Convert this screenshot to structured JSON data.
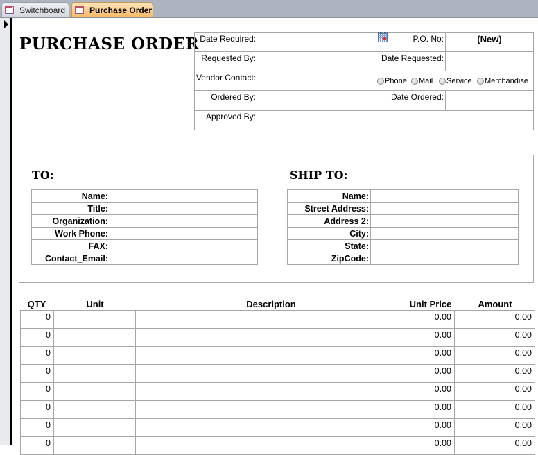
{
  "tabs": [
    {
      "label": "Switchboard",
      "active": false,
      "icon": "form-icon"
    },
    {
      "label": "Purchase Order",
      "active": true,
      "icon": "form-icon"
    }
  ],
  "form": {
    "title": "PURCHASE ORDER",
    "header_fields": {
      "date_required": {
        "label": "Date Required:",
        "value": ""
      },
      "requested_by": {
        "label": "Requested By:",
        "value": ""
      },
      "vendor_contact": {
        "label": "Vendor Contact:",
        "value": ""
      },
      "ordered_by": {
        "label": "Ordered By:",
        "value": ""
      },
      "approved_by": {
        "label": "Approved By:",
        "value": ""
      },
      "po_no": {
        "label": "P.O. No:",
        "value": "(New)"
      },
      "date_requested": {
        "label": "Date Requested:",
        "value": ""
      },
      "date_ordered": {
        "label": "Date Ordered:",
        "value": ""
      }
    },
    "order_type_options": [
      "Phone",
      "Mail",
      "Service",
      "Merchandise"
    ],
    "to": {
      "heading": "TO:",
      "fields": [
        {
          "label": "Name:",
          "value": ""
        },
        {
          "label": "Title:",
          "value": ""
        },
        {
          "label": "Organization:",
          "value": ""
        },
        {
          "label": "Work Phone:",
          "value": ""
        },
        {
          "label": "FAX:",
          "value": ""
        },
        {
          "label": "Contact_Email:",
          "value": ""
        }
      ]
    },
    "ship_to": {
      "heading": "SHIP TO:",
      "fields": [
        {
          "label": "Name:",
          "value": ""
        },
        {
          "label": "Street Address:",
          "value": ""
        },
        {
          "label": "Address 2:",
          "value": ""
        },
        {
          "label": "City:",
          "value": ""
        },
        {
          "label": "State:",
          "value": ""
        },
        {
          "label": "ZipCode:",
          "value": ""
        }
      ]
    },
    "line_items": {
      "columns": [
        "QTY",
        "Unit",
        "Description",
        "Unit Price",
        "Amount"
      ],
      "rows": [
        {
          "qty": "0",
          "unit": "",
          "description": "",
          "unit_price": "0.00",
          "amount": "0.00"
        },
        {
          "qty": "0",
          "unit": "",
          "description": "",
          "unit_price": "0.00",
          "amount": "0.00"
        },
        {
          "qty": "0",
          "unit": "",
          "description": "",
          "unit_price": "0.00",
          "amount": "0.00"
        },
        {
          "qty": "0",
          "unit": "",
          "description": "",
          "unit_price": "0.00",
          "amount": "0.00"
        },
        {
          "qty": "0",
          "unit": "",
          "description": "",
          "unit_price": "0.00",
          "amount": "0.00"
        },
        {
          "qty": "0",
          "unit": "",
          "description": "",
          "unit_price": "0.00",
          "amount": "0.00"
        },
        {
          "qty": "0",
          "unit": "",
          "description": "",
          "unit_price": "0.00",
          "amount": "0.00"
        },
        {
          "qty": "0",
          "unit": "",
          "description": "",
          "unit_price": "0.00",
          "amount": "0.00"
        }
      ]
    }
  }
}
